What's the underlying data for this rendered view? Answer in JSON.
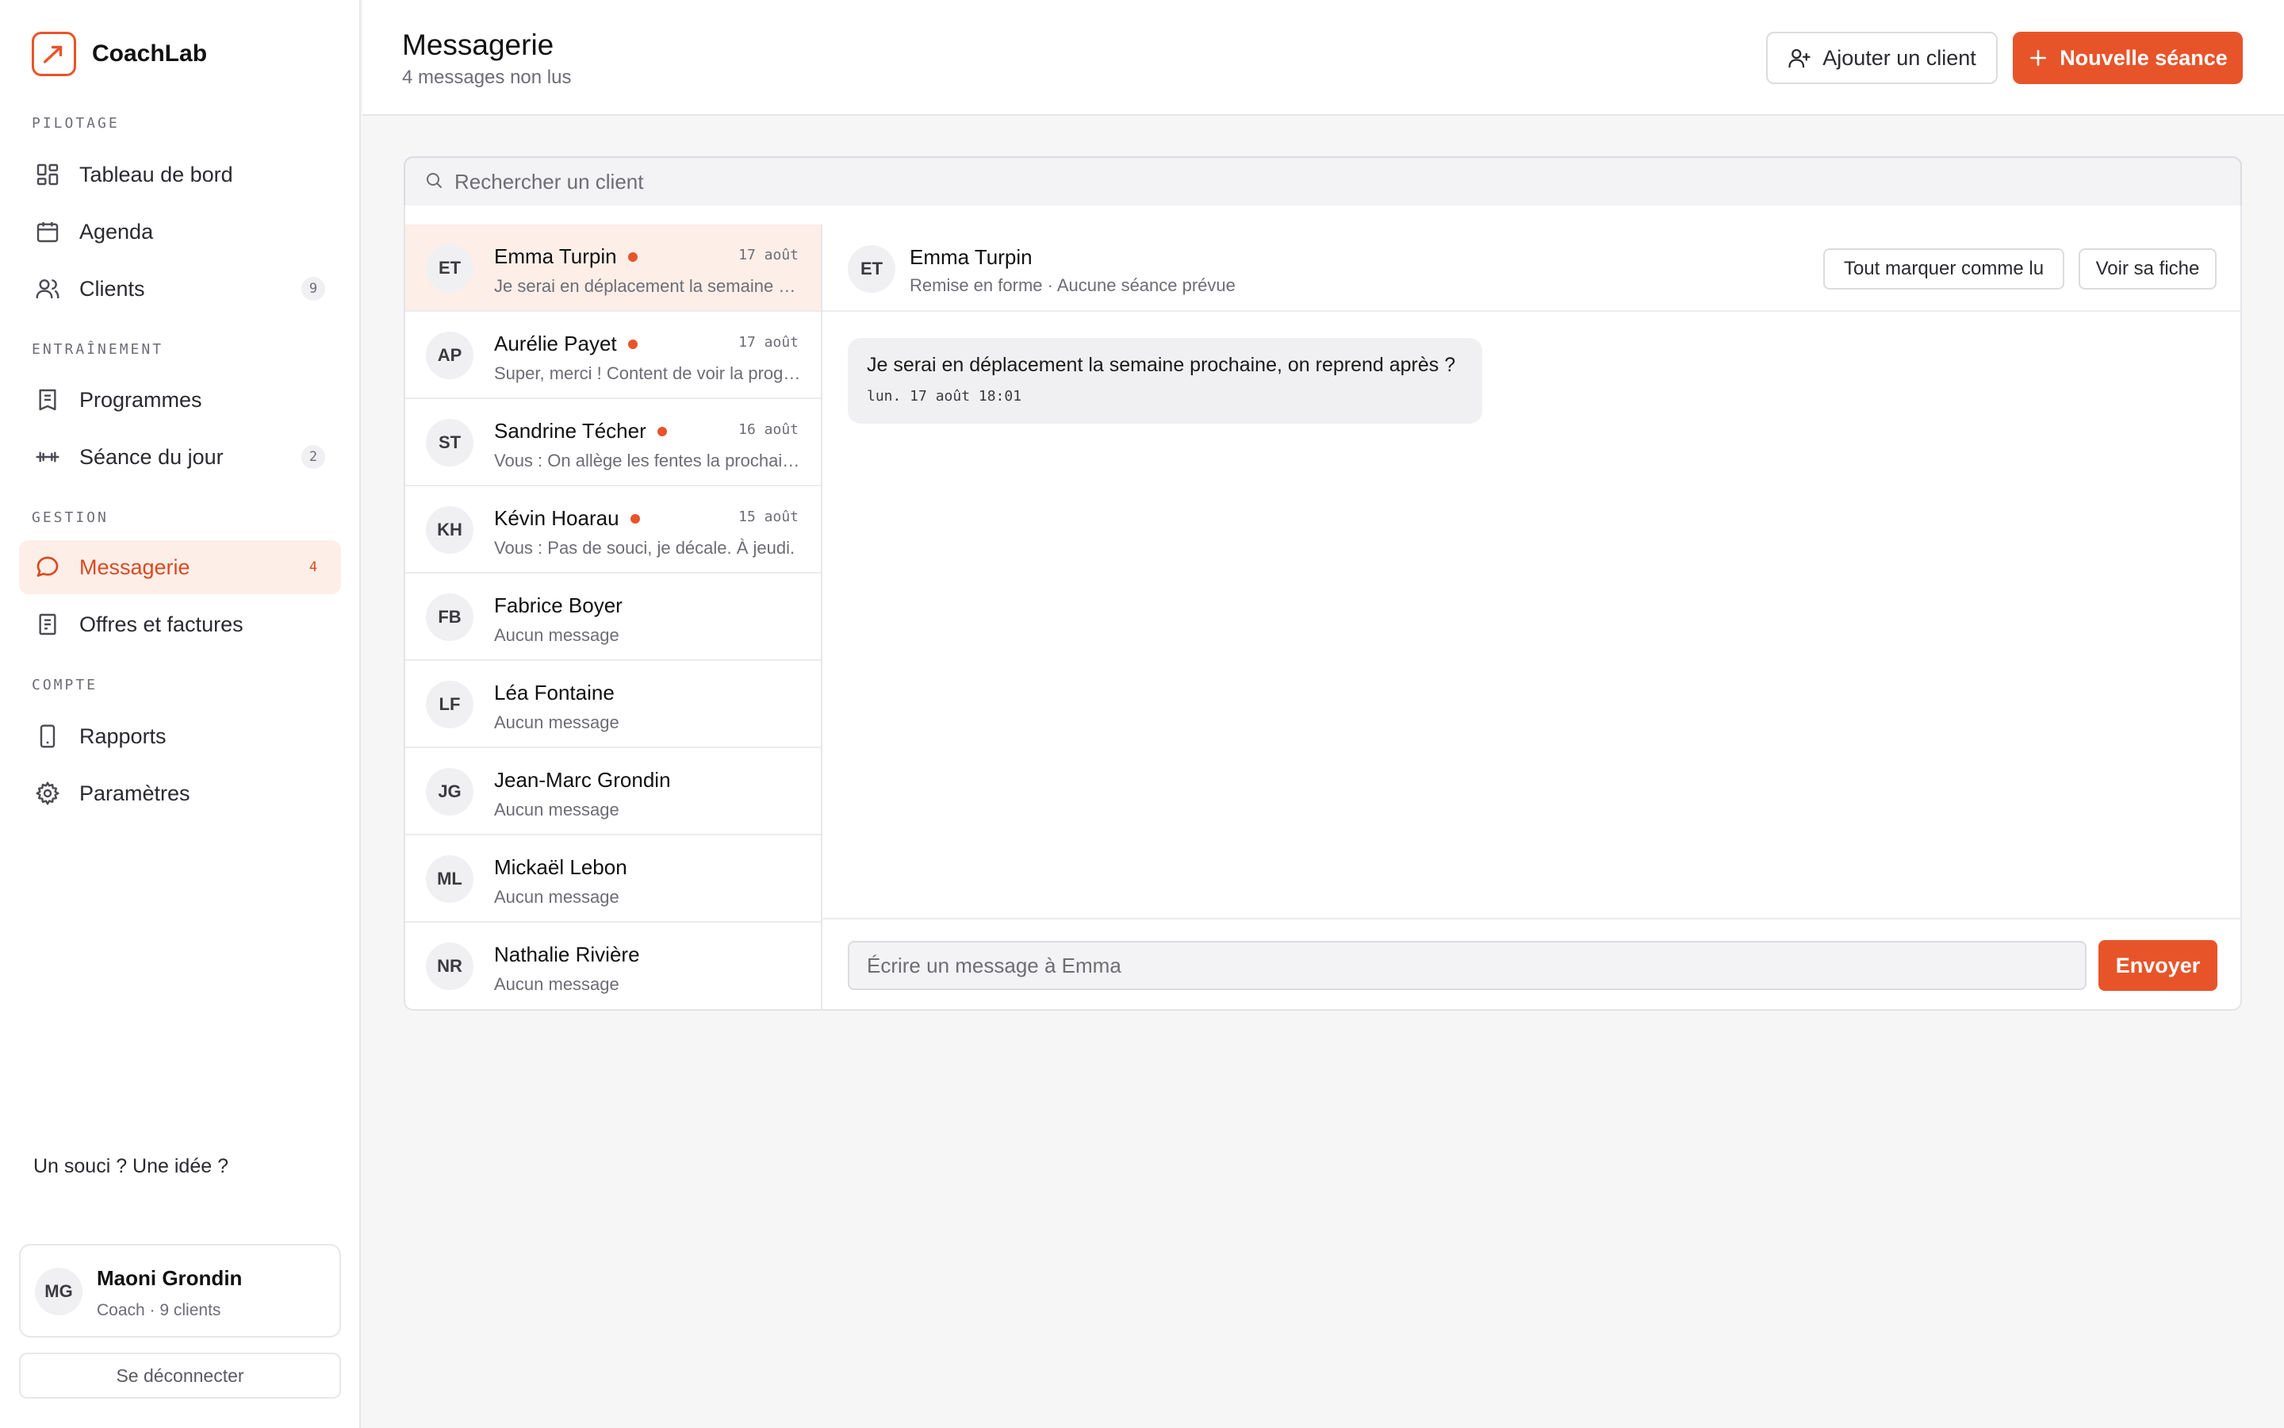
{
  "app": {
    "name": "CoachLab",
    "accent": "#e8542a"
  },
  "nav": {
    "sections": [
      {
        "label": "PILOTAGE",
        "items": [
          {
            "label": "Tableau de bord",
            "icon": "dashboard-icon",
            "badge": ""
          },
          {
            "label": "Agenda",
            "icon": "calendar-icon",
            "badge": ""
          },
          {
            "label": "Clients",
            "icon": "users-icon",
            "badge": "9"
          }
        ]
      },
      {
        "label": "ENTRAÎNEMENT",
        "items": [
          {
            "label": "Programmes",
            "icon": "document-icon",
            "badge": ""
          },
          {
            "label": "Séance du jour",
            "icon": "dumbbell-icon",
            "badge": "2"
          }
        ]
      },
      {
        "label": "GESTION",
        "items": [
          {
            "label": "Messagerie",
            "icon": "chat-icon",
            "badge": "4",
            "active": true
          },
          {
            "label": "Offres et factures",
            "icon": "receipt-icon",
            "badge": ""
          }
        ]
      },
      {
        "label": "COMPTE",
        "items": [
          {
            "label": "Rapports",
            "icon": "phone-icon",
            "badge": ""
          },
          {
            "label": "Paramètres",
            "icon": "gear-icon",
            "badge": ""
          }
        ]
      }
    ]
  },
  "sidebar_footer": {
    "help": "Un souci ? Une idée ?",
    "user": {
      "initials": "MG",
      "name": "Maoni Grondin",
      "sub": "Coach · 9 clients"
    },
    "logout": "Se déconnecter"
  },
  "header": {
    "title": "Messagerie",
    "subtitle": "4 messages non lus",
    "add_client": "Ajouter un client",
    "new_session": "Nouvelle séance"
  },
  "search": {
    "placeholder": "Rechercher un client"
  },
  "conversations": [
    {
      "initials": "ET",
      "name": "Emma Turpin",
      "unread": true,
      "date": "17 août",
      "preview": "Je serai en déplacement la semaine prochaine, on reprend après ?",
      "active": true
    },
    {
      "initials": "AP",
      "name": "Aurélie Payet",
      "unread": true,
      "date": "17 août",
      "preview": "Super, merci ! Content de voir la progression."
    },
    {
      "initials": "ST",
      "name": "Sandrine Técher",
      "unread": true,
      "date": "16 août",
      "preview": "Vous : On allège les fentes la prochaine fois."
    },
    {
      "initials": "KH",
      "name": "Kévin Hoarau",
      "unread": true,
      "date": "15 août",
      "preview": "Vous : Pas de souci, je décale. À jeudi."
    },
    {
      "initials": "FB",
      "name": "Fabrice Boyer",
      "unread": false,
      "date": "",
      "preview": "Aucun message"
    },
    {
      "initials": "LF",
      "name": "Léa Fontaine",
      "unread": false,
      "date": "",
      "preview": "Aucun message"
    },
    {
      "initials": "JG",
      "name": "Jean-Marc Grondin",
      "unread": false,
      "date": "",
      "preview": "Aucun message"
    },
    {
      "initials": "ML",
      "name": "Mickaël Lebon",
      "unread": false,
      "date": "",
      "preview": "Aucun message"
    },
    {
      "initials": "NR",
      "name": "Nathalie Rivière",
      "unread": false,
      "date": "",
      "preview": "Aucun message"
    }
  ],
  "thread": {
    "initials": "ET",
    "name": "Emma Turpin",
    "sub": "Remise en forme · Aucune séance prévue",
    "mark_read": "Tout marquer comme lu",
    "view_profile": "Voir sa fiche",
    "messages": [
      {
        "text": "Je serai en déplacement la semaine prochaine, on reprend après ?",
        "time": "lun. 17 août 18:01"
      }
    ],
    "composer_placeholder": "Écrire un message à Emma",
    "send": "Envoyer"
  }
}
